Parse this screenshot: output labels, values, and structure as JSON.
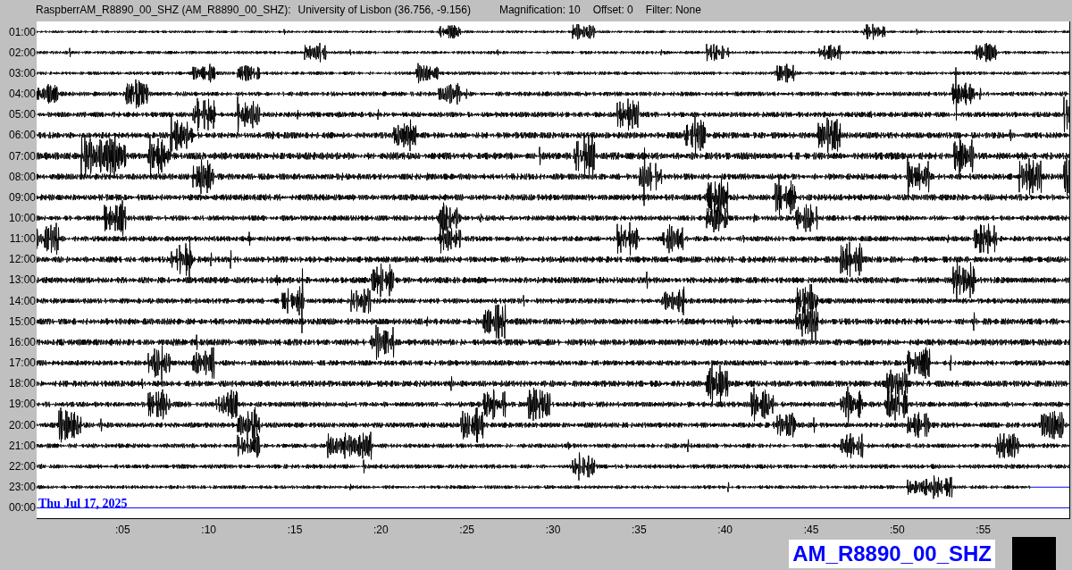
{
  "header": {
    "station": "RaspberrAM_R8890_00_SHZ (AM_R8890_00_SHZ):",
    "location": "University of Lisbon (36.756, -9.156)",
    "magnification": "Magnification: 10",
    "offset": "Offset: 0",
    "filter": "Filter: None"
  },
  "rows": [
    {
      "label": "01:00",
      "kind": "trace"
    },
    {
      "label": "02:00",
      "kind": "trace"
    },
    {
      "label": "03:00",
      "kind": "trace"
    },
    {
      "label": "04:00",
      "kind": "trace"
    },
    {
      "label": "05:00",
      "kind": "trace"
    },
    {
      "label": "06:00",
      "kind": "trace"
    },
    {
      "label": "07:00",
      "kind": "trace"
    },
    {
      "label": "08:00",
      "kind": "trace"
    },
    {
      "label": "09:00",
      "kind": "trace"
    },
    {
      "label": "10:00",
      "kind": "trace"
    },
    {
      "label": "11:00",
      "kind": "trace"
    },
    {
      "label": "12:00",
      "kind": "trace"
    },
    {
      "label": "13:00",
      "kind": "trace"
    },
    {
      "label": "14:00",
      "kind": "trace"
    },
    {
      "label": "15:00",
      "kind": "trace"
    },
    {
      "label": "16:00",
      "kind": "trace"
    },
    {
      "label": "17:00",
      "kind": "trace"
    },
    {
      "label": "18:00",
      "kind": "trace"
    },
    {
      "label": "19:00",
      "kind": "trace"
    },
    {
      "label": "20:00",
      "kind": "trace"
    },
    {
      "label": "21:00",
      "kind": "trace"
    },
    {
      "label": "22:00",
      "kind": "trace"
    },
    {
      "label": "23:00",
      "kind": "partial"
    },
    {
      "label": "00:00",
      "kind": "pending"
    }
  ],
  "date_label": "Thu Jul 17, 2025",
  "x_ticks": [
    ":05",
    ":10",
    ":15",
    ":20",
    ":25",
    ":30",
    ":35",
    ":40",
    ":45",
    ":50",
    ":55"
  ],
  "station_label": "AM_R8890_00_SHZ"
}
